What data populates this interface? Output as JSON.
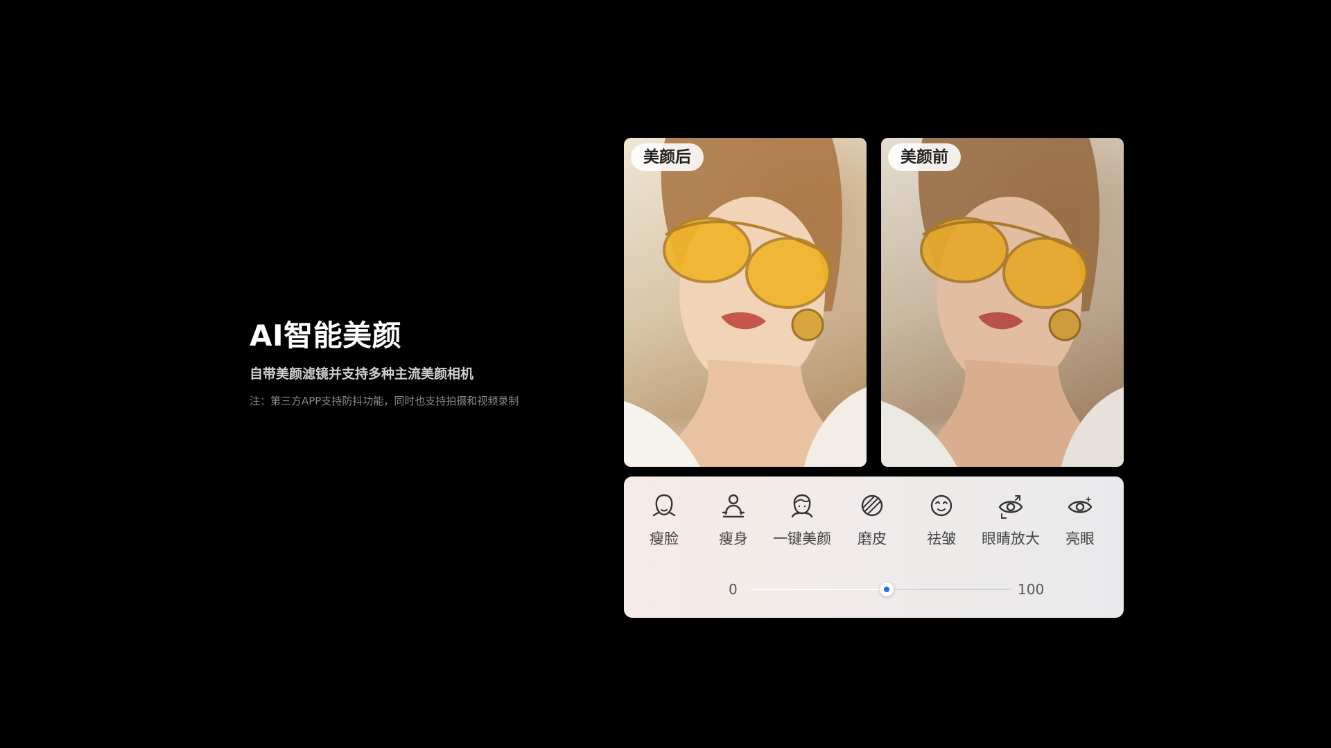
{
  "text": {
    "headline": "AI智能美颜",
    "subtitle": "自带美颜滤镜并支持多种主流美颜相机",
    "note": "注：第三方APP支持防抖功能，同时也支持拍摄和视频录制"
  },
  "photos": {
    "after_label": "美颜后",
    "before_label": "美颜前"
  },
  "panel": {
    "tools": [
      {
        "label": "瘦脸",
        "icon": "face-slim-icon"
      },
      {
        "label": "瘦身",
        "icon": "body-slim-icon"
      },
      {
        "label": "一键美颜",
        "icon": "one-tap-beauty-icon"
      },
      {
        "label": "磨皮",
        "icon": "skin-smooth-icon"
      },
      {
        "label": "祛皱",
        "icon": "wrinkle-remove-icon"
      },
      {
        "label": "眼睛放大",
        "icon": "eye-enlarge-icon"
      },
      {
        "label": "亮眼",
        "icon": "eye-brighten-icon"
      }
    ],
    "slider": {
      "min_label": "0",
      "max_label": "100",
      "value": 52,
      "accent_color": "#1a6ff0"
    }
  }
}
